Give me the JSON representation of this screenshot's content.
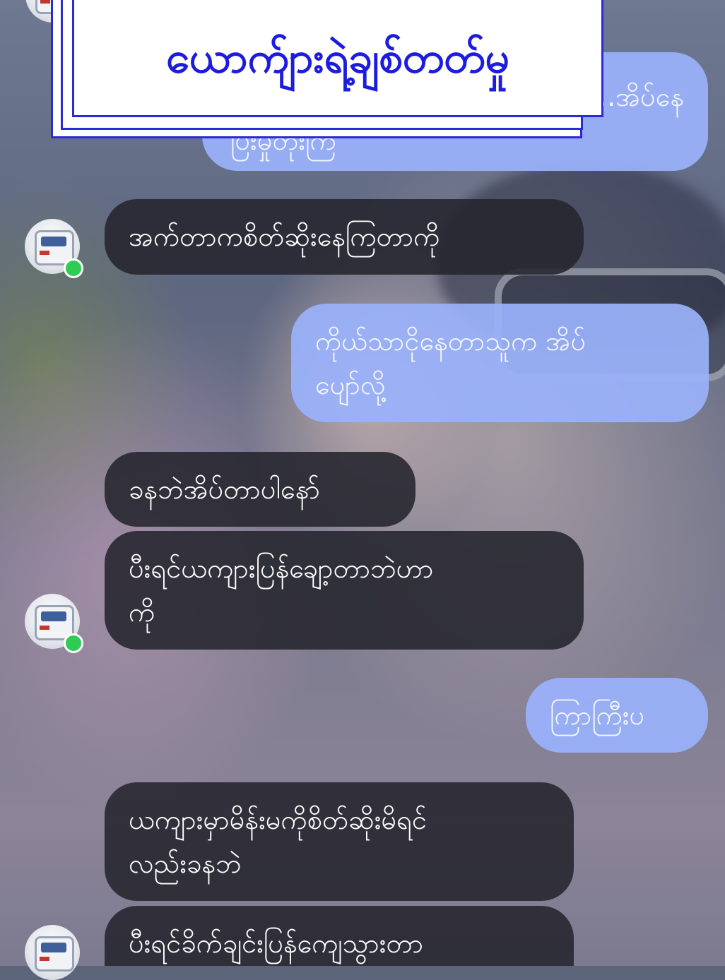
{
  "title": "ယောက်ျားရဲ့ချစ်တတ်မှု",
  "messages": [
    {
      "side": "out",
      "line1": "...အိပ်နေ",
      "line2": "ပြီးမှုတိုးကြ"
    },
    {
      "side": "in",
      "text": "အက်တာကစိတ်ဆိုးနေကြတာကို"
    },
    {
      "side": "out",
      "line1": "ကိုယ်သာငိုနေတာသူက အိပ်",
      "line2": "ပျော်လို့"
    },
    {
      "side": "in",
      "text": "ခနဘဲအိပ်တာပါနော်"
    },
    {
      "side": "in",
      "line1": "ပီးရင်ယကျားပြန်ချော့တာဘဲဟာ",
      "line2": "ကို"
    },
    {
      "side": "out",
      "text": "ကြာကြီးပ"
    },
    {
      "side": "in",
      "line1": "ယကျားမှာမိန်းမကိုစိတ်ဆိုးမိရင်",
      "line2": "လည်းခနဘဲ"
    },
    {
      "side": "in",
      "text": "ပီးရင်ခိက်ချင်းပြန်ကျေသွားတာ"
    }
  ],
  "colors": {
    "outgoing_bubble": "#9ab2fb",
    "incoming_bubble": "#24242e",
    "title_text": "#1c1ce0",
    "title_border": "#2b2bd4",
    "online_indicator": "#2ecc52"
  },
  "icons": {
    "avatar": "truck-avatar-icon",
    "online": "online-status-dot"
  }
}
